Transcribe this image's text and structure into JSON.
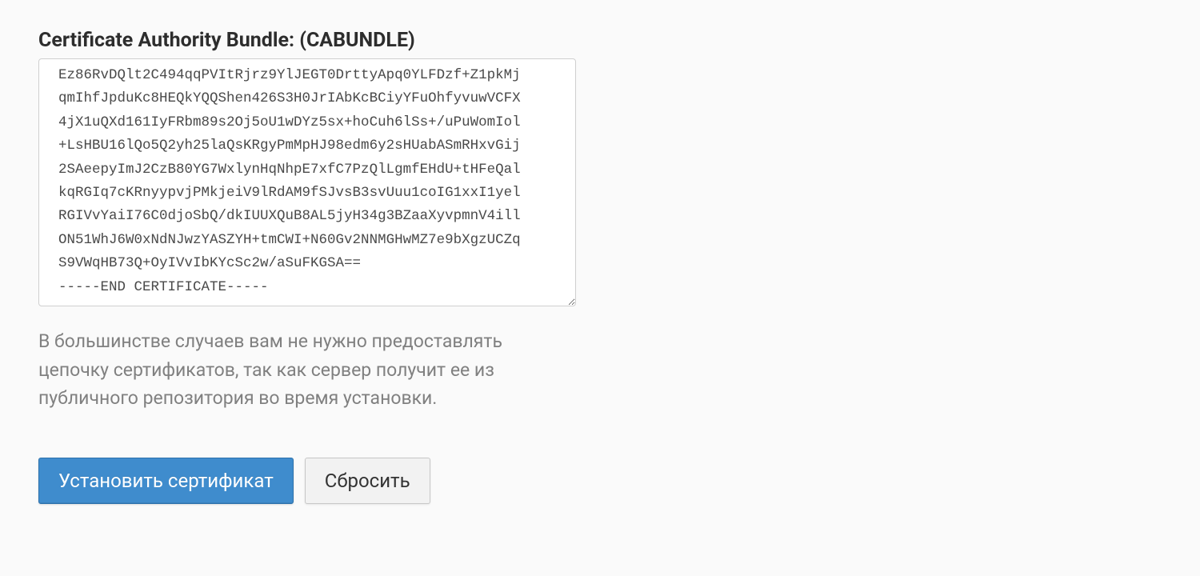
{
  "form": {
    "cabundle": {
      "label": "Certificate Authority Bundle: (CABUNDLE)",
      "value": "Ez86RvDQlt2C494qqPVItRjrz9YlJEGT0DrttyApq0YLFDzf+Z1pkMj\nqmIhfJpduKc8HEQkYQQShen426S3H0JrIAbKcBCiyYFuOhfyvuwVCFX\n4jX1uQXd161IyFRbm89s2Oj5oU1wDYz5sx+hoCuh6lSs+/uPuWomIol\n+LsHBU16lQo5Q2yh25laQsKRgyPmMpHJ98edm6y2sHUabASmRHxvGij\n2SAeepyImJ2CzB80YG7WxlynHqNhpE7xfC7PzQlLgmfEHdU+tHFeQal\nkqRGIq7cKRnyypvjPMkjeiV9lRdAM9fSJvsB3svUuu1coIG1xxI1yel\nRGIVvYaiI76C0djoSbQ/dkIUUXQuB8AL5jyH34g3BZaaXyvpmnV4ill\nON51WhJ6W0xNdNJwzYASZYH+tmCWI+N60Gv2NNMGHwMZ7e9bXgzUCZq\nS9VWqHB73Q+OyIVvIbKYcSc2w/aSuFKGSA==\n-----END CERTIFICATE-----"
    },
    "help_text": "В большинстве случаев вам не нужно предоставлять цепочку сертификатов, так как сервер получит ее из публичного репозитория во время установки.",
    "buttons": {
      "install": "Установить сертификат",
      "reset": "Сбросить"
    }
  }
}
